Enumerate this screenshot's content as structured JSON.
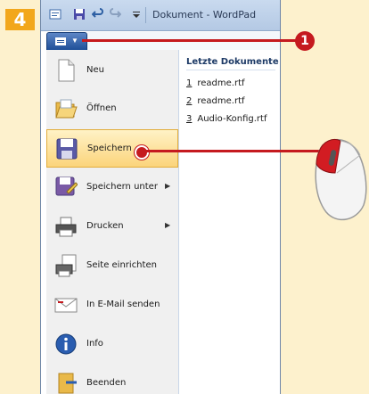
{
  "step": {
    "number": "4"
  },
  "window": {
    "title": "Dokument - WordPad"
  },
  "callout": {
    "number": "1"
  },
  "menu": {
    "items": [
      {
        "label": "Neu",
        "icon": "new-document-icon",
        "has_submenu": false
      },
      {
        "label": "Öffnen",
        "icon": "open-folder-icon",
        "has_submenu": false
      },
      {
        "label": "Speichern",
        "icon": "save-icon",
        "has_submenu": false,
        "selected": true
      },
      {
        "label": "Speichern unter",
        "icon": "save-as-icon",
        "has_submenu": true
      },
      {
        "label": "Drucken",
        "icon": "printer-icon",
        "has_submenu": true
      },
      {
        "label": "Seite einrichten",
        "icon": "page-setup-icon",
        "has_submenu": false
      },
      {
        "label": "In E-Mail senden",
        "icon": "email-icon",
        "has_submenu": false
      },
      {
        "label": "Info",
        "icon": "info-icon",
        "has_submenu": false
      },
      {
        "label": "Beenden",
        "icon": "exit-icon",
        "has_submenu": false
      }
    ]
  },
  "recent": {
    "heading": "Letzte Dokumente",
    "items": [
      {
        "num": "1",
        "name": "readme.rtf"
      },
      {
        "num": "2",
        "name": "readme.rtf"
      },
      {
        "num": "3",
        "name": "Audio-Konfig.rtf"
      }
    ]
  },
  "colors": {
    "accent": "#c51a1f",
    "badge": "#f2a71b",
    "background": "#fdf1cd",
    "selection": "#fbd47b"
  }
}
